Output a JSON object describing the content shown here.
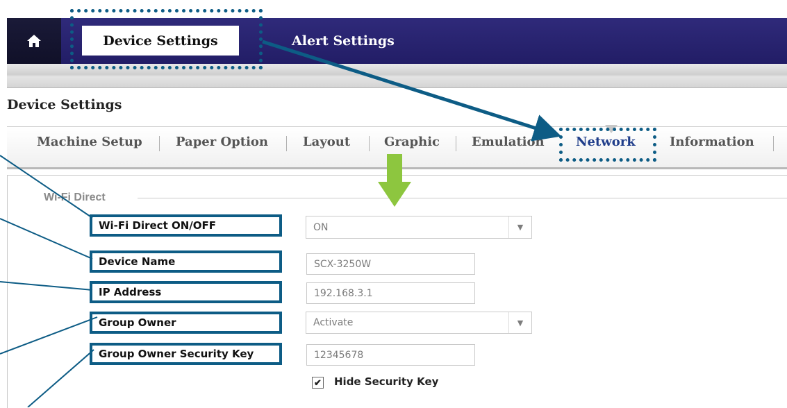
{
  "top_nav": {
    "home_icon": "home-icon",
    "tabs": [
      {
        "label": "Device Settings",
        "active": true
      },
      {
        "label": "Alert Settings",
        "active": false
      }
    ]
  },
  "section": {
    "title": "Device Settings"
  },
  "sub_nav": {
    "items": [
      "Machine Setup",
      "Paper Option",
      "Layout",
      "Graphic",
      "Emulation",
      "Network",
      "Information"
    ],
    "active": "Network"
  },
  "wifi_direct": {
    "legend": "Wi-Fi Direct",
    "rows": [
      {
        "label": "Wi-Fi Direct ON/OFF",
        "value": "ON",
        "kind": "select"
      },
      {
        "label": "Device Name",
        "value": "SCX-3250W",
        "kind": "text"
      },
      {
        "label": "IP Address",
        "value": "192.168.3.1",
        "kind": "text"
      },
      {
        "label": "Group Owner",
        "value": "Activate",
        "kind": "select"
      },
      {
        "label": "Group Owner Security Key",
        "value": "12345678",
        "kind": "text"
      }
    ],
    "hide_key": {
      "label": "Hide Security Key",
      "checked": true
    }
  },
  "colors": {
    "nav": "#2a2475",
    "highlight": "#0d5c85",
    "arrow_green": "#8dc63f",
    "active_subnav": "#1f3d8a"
  }
}
